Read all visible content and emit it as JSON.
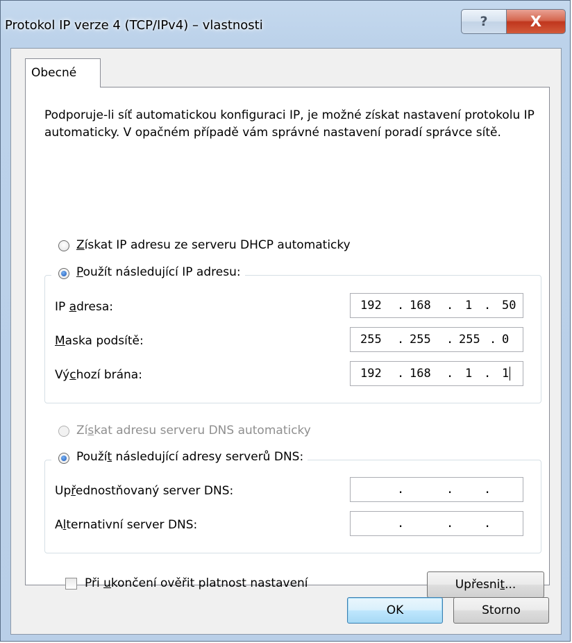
{
  "window": {
    "title": "Protokol IP verze 4 (TCP/IPv4) – vlastnosti",
    "help_glyph": "?",
    "close_glyph": "X"
  },
  "tabs": [
    {
      "label": "Obecné"
    }
  ],
  "description": "Podporuje-li síť automatickou konfiguraci IP, je možné získat nastavení protokolu IP automaticky. V opačném případě vám správné nastavení poradí správce sítě.",
  "ip_section": {
    "auto_option": {
      "pre": "",
      "mnemonic": "Z",
      "post": "ískat IP adresu ze serveru DHCP automaticky",
      "checked": false
    },
    "manual_option": {
      "pre": "",
      "mnemonic": "P",
      "post": "oužít následující IP adresu:",
      "checked": true
    },
    "fields": [
      {
        "label_pre": "IP ",
        "label_mn": "a",
        "label_post": "dresa:",
        "octets": [
          "192",
          "168",
          "1",
          "50"
        ]
      },
      {
        "label_pre": "",
        "label_mn": "M",
        "label_post": "aska podsítě:",
        "octets": [
          "255",
          "255",
          "255",
          "0"
        ]
      },
      {
        "label_pre": "Vý",
        "label_mn": "c",
        "label_post": "hozí brána:",
        "octets": [
          "192",
          "168",
          "1",
          "1"
        ]
      }
    ]
  },
  "dns_section": {
    "auto_option": {
      "pre": "Zí",
      "mnemonic": "s",
      "post": "kat adresu serveru DNS automaticky",
      "enabled": false
    },
    "manual_option": {
      "pre": "Použí",
      "mnemonic": "t",
      "post": " následující adresy serverů DNS:",
      "checked": true
    },
    "fields": [
      {
        "label_pre": "Up",
        "label_mn": "ř",
        "label_post": "ednostňovaný server DNS:",
        "octets": [
          "",
          "",
          "",
          ""
        ]
      },
      {
        "label_pre": "A",
        "label_mn": "l",
        "label_post": "ternativní server DNS:",
        "octets": [
          "",
          "",
          "",
          ""
        ]
      }
    ]
  },
  "validate_checkbox": {
    "pre": "Při ",
    "mnemonic": "u",
    "post": "končení ověřit platnost nastavení",
    "checked": false
  },
  "buttons": {
    "advanced": {
      "pre": "Upřesni",
      "mnemonic": "t",
      "post": "..."
    },
    "ok": "OK",
    "cancel": "Storno"
  },
  "separator": "."
}
